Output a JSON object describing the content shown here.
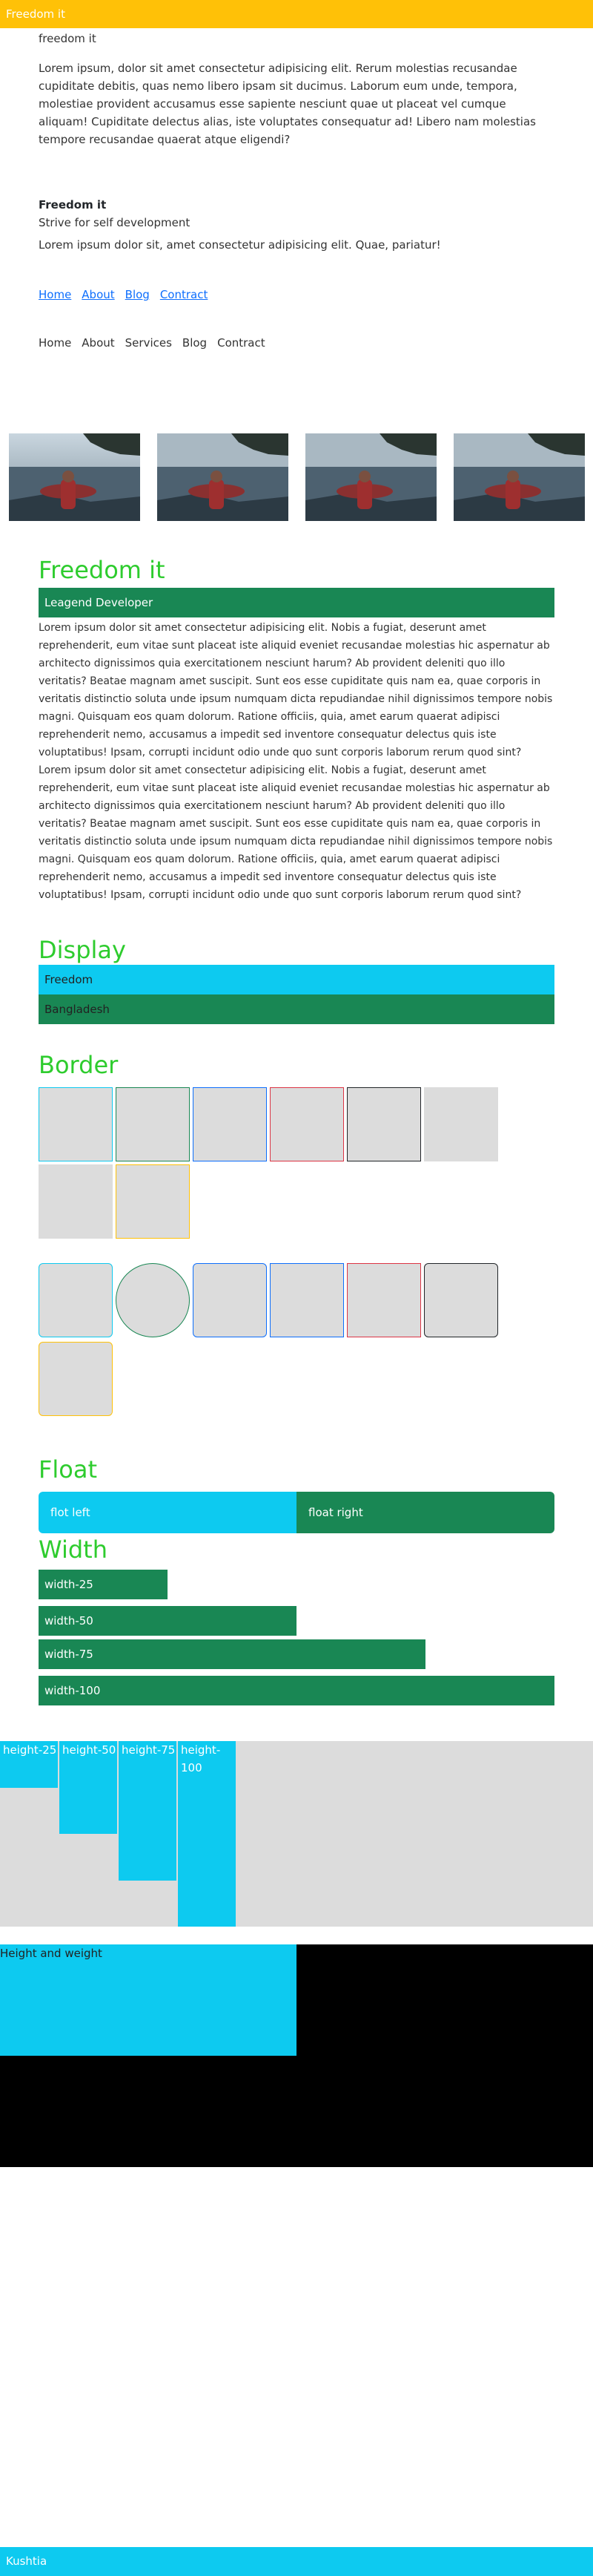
{
  "navbar": {
    "brand": "Freedom it"
  },
  "intro": {
    "subtitle": "freedom it",
    "paragraph": "Lorem ipsum, dolor sit amet consectetur adipisicing elit. Rerum molestias recusandae cupiditate debitis, quas nemo libero ipsam sit ducimus. Laborum eum unde, tempora, molestiae provident accusamus esse sapiente nesciunt quae ut placeat vel cumque aliquam! Cupiditate delectus alias, iste voluptates consequatur ad! Libero nam molestias tempore recusandae quaerat atque eligendi?"
  },
  "about": {
    "title": "Freedom it",
    "tagline": "Strive for self development",
    "text": "Lorem ipsum dolor sit, amet consectetur adipisicing elit. Quae, pariatur!"
  },
  "links": [
    "Home",
    "About",
    "Blog",
    "Contract"
  ],
  "nav_plain": [
    "Home",
    "About",
    "Services",
    "Blog",
    "Contract"
  ],
  "section1": {
    "heading": "Freedom it",
    "banner": "Leagend Developer",
    "body": "Lorem ipsum dolor sit amet consectetur adipisicing elit. Nobis a fugiat, deserunt amet reprehenderit, eum vitae sunt placeat iste aliquid eveniet recusandae molestias hic aspernatur ab architecto dignissimos quia exercitationem nesciunt harum? Ab provident deleniti quo illo veritatis? Beatae magnam amet suscipit. Sunt eos esse cupiditate quis nam ea, quae corporis in veritatis distinctio soluta unde ipsum numquam dicta repudiandae nihil dignissimos tempore nobis magni. Quisquam eos quam dolorum. Ratione officiis, quia, amet earum quaerat adipisci reprehenderit nemo, accusamus a impedit sed inventore consequatur delectus quis iste voluptatibus! Ipsam, corrupti incidunt odio unde quo sunt corporis laborum rerum quod sint? Lorem ipsum dolor sit amet consectetur adipisicing elit. Nobis a fugiat, deserunt amet reprehenderit, eum vitae sunt placeat iste aliquid eveniet recusandae molestias hic aspernatur ab architecto dignissimos quia exercitationem nesciunt harum? Ab provident deleniti quo illo veritatis? Beatae magnam amet suscipit. Sunt eos esse cupiditate quis nam ea, quae corporis in veritatis distinctio soluta unde ipsum numquam dicta repudiandae nihil dignissimos tempore nobis magni. Quisquam eos quam dolorum. Ratione officiis, quia, amet earum quaerat adipisci reprehenderit nemo, accusamus a impedit sed inventore consequatur delectus quis iste voluptatibus! Ipsam, corrupti incidunt odio unde quo sunt corporis laborum rerum quod sint?"
  },
  "display": {
    "heading": "Display",
    "row1": "Freedom",
    "row2": "Bangladesh"
  },
  "border": {
    "heading": "Border"
  },
  "float": {
    "heading": "Float",
    "left": "flot left",
    "right": "float right"
  },
  "width": {
    "heading": "Width",
    "bars": [
      {
        "label": "width-25",
        "fraction": 0.25
      },
      {
        "label": "width-50",
        "fraction": 0.5
      },
      {
        "label": "width-75",
        "fraction": 0.75
      },
      {
        "label": "width-100",
        "fraction": 1.0
      }
    ]
  },
  "height": {
    "bars": [
      {
        "label": "height-25",
        "fraction": 0.25
      },
      {
        "label": "height-50",
        "fraction": 0.5
      },
      {
        "label": "height-75",
        "fraction": 0.75
      },
      {
        "label": "height-100",
        "fraction": 1.0
      }
    ]
  },
  "height_weight": {
    "label": "Height and weight"
  },
  "footer": {
    "text": "Kushtia"
  },
  "colors": {
    "warning": "#ffc107",
    "info": "#0dcaf0",
    "success": "#198754",
    "primary": "#0d6efd",
    "danger": "#dc3545",
    "heading_green": "#2ecc2e",
    "box_gray": "#dcdcdc"
  }
}
